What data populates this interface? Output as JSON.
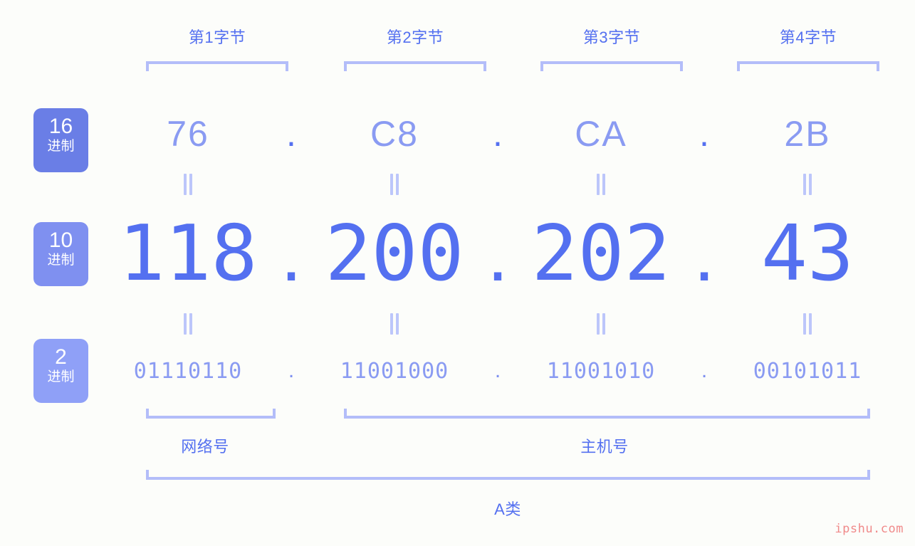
{
  "background_color": "#fcfdfa",
  "accent_color": "#5470f0",
  "bracket_color": "#b3bdf9",
  "byte_headers": [
    {
      "label": "第1字节"
    },
    {
      "label": "第2字节"
    },
    {
      "label": "第3字节"
    },
    {
      "label": "第4字节"
    }
  ],
  "radix_badges": [
    {
      "num": "16",
      "unit": "进制",
      "color": "#6a7ee6"
    },
    {
      "num": "10",
      "unit": "进制",
      "color": "#7f90f0"
    },
    {
      "num": "2",
      "unit": "进制",
      "color": "#8fa0f7"
    }
  ],
  "separator": ".",
  "equals_glyph": "=",
  "rows": {
    "hex": {
      "radix": "16",
      "octets": [
        "76",
        "C8",
        "CA",
        "2B"
      ]
    },
    "decimal": {
      "radix": "10",
      "octets": [
        "118",
        "200",
        "202",
        "43"
      ]
    },
    "binary": {
      "radix": "2",
      "octets": [
        "01110110",
        "11001000",
        "11001010",
        "00101011"
      ]
    }
  },
  "sections": {
    "network": {
      "label": "网络号"
    },
    "host": {
      "label": "主机号"
    },
    "class": {
      "label": "A类"
    }
  },
  "watermark": "ipshu.com"
}
